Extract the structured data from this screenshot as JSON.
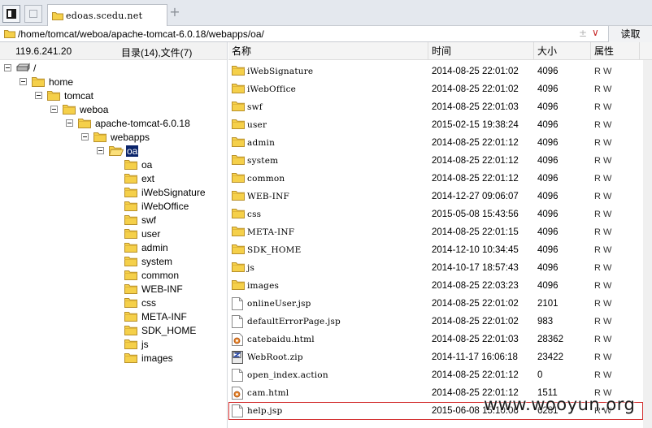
{
  "tabbar": {
    "tab_title": "edoas.scedu.net",
    "add_tab": "+"
  },
  "address": {
    "path": "/home/tomcat/weboa/apache-tomcat-6.0.18/webapps/oa/",
    "plus": "±",
    "chevron": "∨",
    "read_label": "读取"
  },
  "tree": {
    "ip": "119.6.241.20",
    "count_label": "目录(14),文件(7)",
    "nodes": [
      {
        "label": "/",
        "depth": 0,
        "icon": "drive-icon",
        "expanded": true
      },
      {
        "label": "home",
        "depth": 1,
        "icon": "folder-icon",
        "expanded": true
      },
      {
        "label": "tomcat",
        "depth": 2,
        "icon": "folder-icon",
        "expanded": true
      },
      {
        "label": "weboa",
        "depth": 3,
        "icon": "folder-icon",
        "expanded": true
      },
      {
        "label": "apache-tomcat-6.0.18",
        "depth": 4,
        "icon": "folder-icon",
        "expanded": true
      },
      {
        "label": "webapps",
        "depth": 5,
        "icon": "folder-icon",
        "expanded": true
      },
      {
        "label": "oa",
        "depth": 6,
        "icon": "folder-open-icon",
        "expanded": true,
        "selected": true
      },
      {
        "label": "oa",
        "depth": 7,
        "icon": "folder-icon"
      },
      {
        "label": "ext",
        "depth": 7,
        "icon": "folder-icon"
      },
      {
        "label": "iWebSignature",
        "depth": 7,
        "icon": "folder-icon"
      },
      {
        "label": "iWebOffice",
        "depth": 7,
        "icon": "folder-icon"
      },
      {
        "label": "swf",
        "depth": 7,
        "icon": "folder-icon"
      },
      {
        "label": "user",
        "depth": 7,
        "icon": "folder-icon"
      },
      {
        "label": "admin",
        "depth": 7,
        "icon": "folder-icon"
      },
      {
        "label": "system",
        "depth": 7,
        "icon": "folder-icon"
      },
      {
        "label": "common",
        "depth": 7,
        "icon": "folder-icon"
      },
      {
        "label": "WEB-INF",
        "depth": 7,
        "icon": "folder-icon"
      },
      {
        "label": "css",
        "depth": 7,
        "icon": "folder-icon"
      },
      {
        "label": "META-INF",
        "depth": 7,
        "icon": "folder-icon"
      },
      {
        "label": "SDK_HOME",
        "depth": 7,
        "icon": "folder-icon"
      },
      {
        "label": "js",
        "depth": 7,
        "icon": "folder-icon"
      },
      {
        "label": "images",
        "depth": 7,
        "icon": "folder-icon"
      }
    ]
  },
  "list": {
    "columns": {
      "name": "名称",
      "time": "时间",
      "size": "大小",
      "attr": "属性"
    },
    "rows": [
      {
        "name": "iWebSignature",
        "time": "2014-08-25 22:01:02",
        "size": "4096",
        "attr": "R W",
        "icon": "folder-icon"
      },
      {
        "name": "iWebOffice",
        "time": "2014-08-25 22:01:02",
        "size": "4096",
        "attr": "R W",
        "icon": "folder-icon"
      },
      {
        "name": "swf",
        "time": "2014-08-25 22:01:03",
        "size": "4096",
        "attr": "R W",
        "icon": "folder-icon"
      },
      {
        "name": "user",
        "time": "2015-02-15 19:38:24",
        "size": "4096",
        "attr": "R W",
        "icon": "folder-icon"
      },
      {
        "name": "admin",
        "time": "2014-08-25 22:01:12",
        "size": "4096",
        "attr": "R W",
        "icon": "folder-icon"
      },
      {
        "name": "system",
        "time": "2014-08-25 22:01:12",
        "size": "4096",
        "attr": "R W",
        "icon": "folder-icon"
      },
      {
        "name": "common",
        "time": "2014-08-25 22:01:12",
        "size": "4096",
        "attr": "R W",
        "icon": "folder-icon"
      },
      {
        "name": "WEB-INF",
        "time": "2014-12-27 09:06:07",
        "size": "4096",
        "attr": "R W",
        "icon": "folder-icon"
      },
      {
        "name": "css",
        "time": "2015-05-08 15:43:56",
        "size": "4096",
        "attr": "R W",
        "icon": "folder-icon"
      },
      {
        "name": "META-INF",
        "time": "2014-08-25 22:01:15",
        "size": "4096",
        "attr": "R W",
        "icon": "folder-icon"
      },
      {
        "name": "SDK_HOME",
        "time": "2014-12-10 10:34:45",
        "size": "4096",
        "attr": "R W",
        "icon": "folder-icon"
      },
      {
        "name": "js",
        "time": "2014-10-17 18:57:43",
        "size": "4096",
        "attr": "R W",
        "icon": "folder-icon"
      },
      {
        "name": "images",
        "time": "2014-08-25 22:03:23",
        "size": "4096",
        "attr": "R W",
        "icon": "folder-icon"
      },
      {
        "name": "onlineUser.jsp",
        "time": "2014-08-25 22:01:02",
        "size": "2101",
        "attr": "R W",
        "icon": "file-icon"
      },
      {
        "name": "defaultErrorPage.jsp",
        "time": "2014-08-25 22:01:02",
        "size": "983",
        "attr": "R W",
        "icon": "file-icon"
      },
      {
        "name": "catebaidu.html",
        "time": "2014-08-25 22:01:03",
        "size": "28362",
        "attr": "R W",
        "icon": "html-file-icon"
      },
      {
        "name": "WebRoot.zip",
        "time": "2014-11-17 16:06:18",
        "size": "23422",
        "attr": "R W",
        "icon": "zip-file-icon"
      },
      {
        "name": "open_index.action",
        "time": "2014-08-25 22:01:12",
        "size": "0",
        "attr": "R W",
        "icon": "file-icon"
      },
      {
        "name": "cam.html",
        "time": "2014-08-25 22:01:12",
        "size": "1511",
        "attr": "R W",
        "icon": "html-file-icon"
      },
      {
        "name": "help.jsp",
        "time": "2015-06-08 15:10:06",
        "size": "6281",
        "attr": "R W",
        "icon": "file-icon",
        "highlighted": true
      }
    ]
  },
  "watermark": "www.wooyun.org",
  "colors": {
    "accent_red": "#d32f2f",
    "selection": "#0a246a",
    "folder_yellow": "#f5d04a"
  }
}
